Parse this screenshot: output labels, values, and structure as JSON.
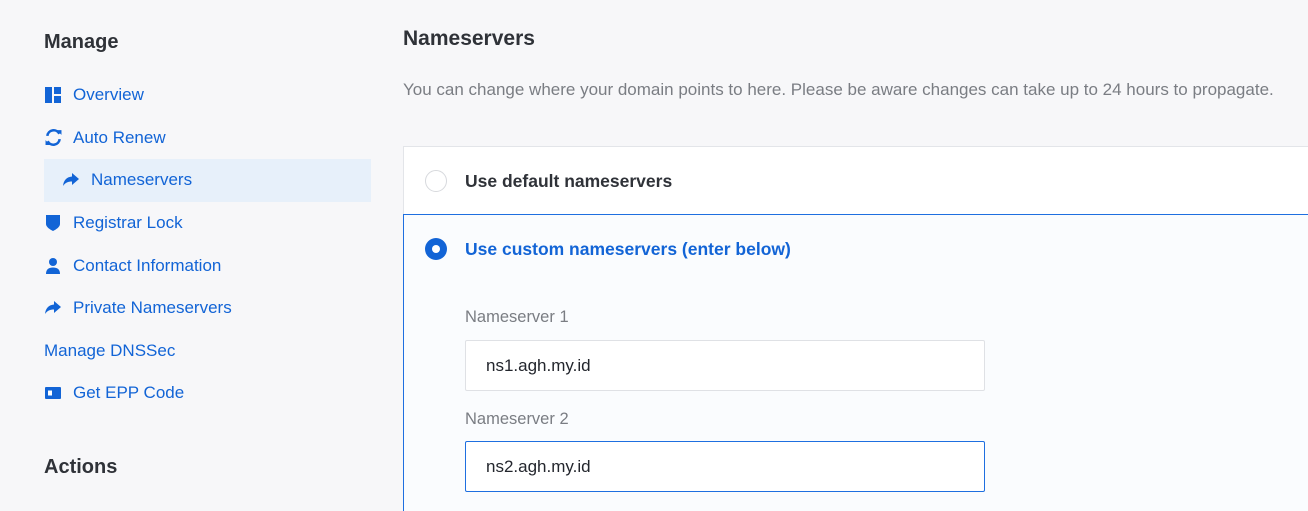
{
  "sidebar": {
    "manage_heading": "Manage",
    "actions_heading": "Actions",
    "items": [
      {
        "label": "Overview",
        "icon": "dashboard-icon"
      },
      {
        "label": "Auto Renew",
        "icon": "sync-icon"
      },
      {
        "label": "Nameservers",
        "icon": "share-arrow-icon",
        "active": true
      },
      {
        "label": "Registrar Lock",
        "icon": "shield-icon"
      },
      {
        "label": "Contact Information",
        "icon": "user-icon"
      },
      {
        "label": "Private Nameservers",
        "icon": "share-arrow-icon"
      },
      {
        "label": "Manage DNSSec"
      },
      {
        "label": "Get EPP Code",
        "icon": "id-card-icon"
      }
    ]
  },
  "main": {
    "title": "Nameservers",
    "description": "You can change where your domain points to here. Please be aware changes can take up to 24 hours to propagate.",
    "option_default": "Use default nameservers",
    "option_custom": "Use custom nameservers (enter below)",
    "selected_option": "custom",
    "ns1_label": "Nameserver 1",
    "ns1_value": "ns1.agh.my.id",
    "ns2_label": "Nameserver 2",
    "ns2_value": "ns2.agh.my.id"
  },
  "colors": {
    "accent": "#1264d6",
    "active_bg": "#e7f0fa",
    "page_bg": "#f7f7f9"
  }
}
